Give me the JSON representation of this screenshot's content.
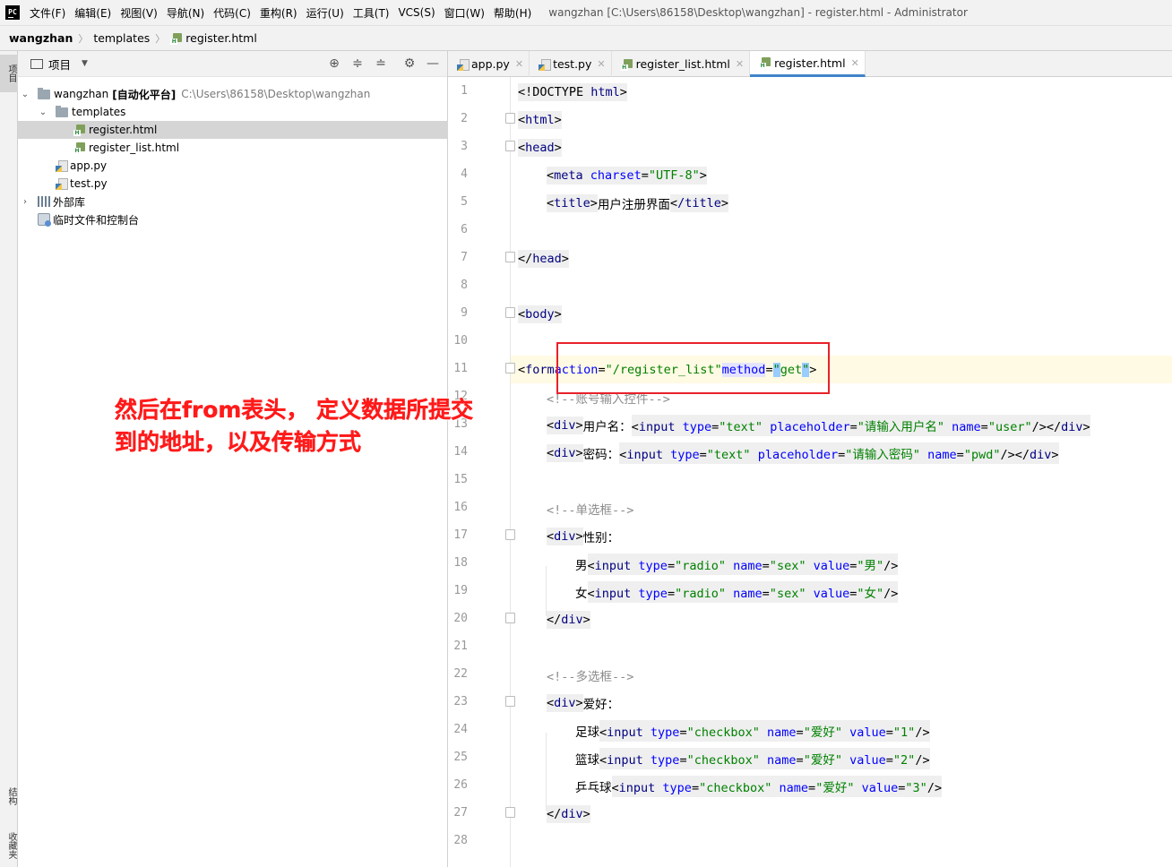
{
  "menubar": {
    "logo": "PC",
    "items": [
      "文件(F)",
      "编辑(E)",
      "视图(V)",
      "导航(N)",
      "代码(C)",
      "重构(R)",
      "运行(U)",
      "工具(T)",
      "VCS(S)",
      "窗口(W)",
      "帮助(H)"
    ],
    "window_title": "wangzhan [C:\\Users\\86158\\Desktop\\wangzhan] - register.html - Administrator"
  },
  "breadcrumb": [
    "wangzhan",
    "templates",
    "register.html"
  ],
  "left_strip": {
    "top": "项目",
    "middle": "结构",
    "bottom": "收藏夹"
  },
  "project_panel": {
    "title": "项目",
    "tree": {
      "root_name": "wangzhan",
      "root_tag": "[自动化平台]",
      "root_path": "C:\\Users\\86158\\Desktop\\wangzhan",
      "templates": "templates",
      "register_html": "register.html",
      "register_list_html": "register_list.html",
      "app_py": "app.py",
      "test_py": "test.py",
      "external_libs": "外部库",
      "scratches": "临时文件和控制台"
    }
  },
  "editor_tabs": [
    "app.py",
    "test.py",
    "register_list.html",
    "register.html"
  ],
  "active_tab": "register.html",
  "line_numbers": [
    "1",
    "2",
    "3",
    "4",
    "5",
    "6",
    "7",
    "8",
    "9",
    "10",
    "11",
    "12",
    "13",
    "14",
    "15",
    "16",
    "17",
    "18",
    "19",
    "20",
    "21",
    "22",
    "23",
    "24",
    "25",
    "26",
    "27",
    "28"
  ],
  "code": {
    "l1": [
      "<!DOCTYPE ",
      "html",
      ">"
    ],
    "l4": [
      "meta",
      "charset",
      "UTF-8"
    ],
    "l5": [
      "title",
      "用户注册界面",
      "/title"
    ],
    "l11": [
      "form",
      "action",
      "/register_list",
      "method",
      "get"
    ],
    "l12": "<!--账号输入控件-->",
    "l13": {
      "label": "用户名：",
      "type": "text",
      "placeholder": "请输入用户名",
      "name": "user"
    },
    "l14": {
      "label": "密码：",
      "type": "text",
      "placeholder": "请输入密码",
      "name": "pwd"
    },
    "l16": "<!--单选框-->",
    "l17": "性别：",
    "l18": {
      "label": "男",
      "type": "radio",
      "name": "sex",
      "value": "男"
    },
    "l19": {
      "label": "女",
      "type": "radio",
      "name": "sex",
      "value": "女"
    },
    "l22": "<!--多选框-->",
    "l23": "爱好：",
    "l24": {
      "label": "足球",
      "type": "checkbox",
      "name": "爱好",
      "value": "1"
    },
    "l25": {
      "label": "篮球",
      "type": "checkbox",
      "name": "爱好",
      "value": "2"
    },
    "l26": {
      "label": "乒乓球",
      "type": "checkbox",
      "name": "爱好",
      "value": "3"
    }
  },
  "annotation": {
    "line1": "然后在from表头， 定义数据所提交",
    "line2": "到的地址，以及传输方式"
  },
  "colors": {
    "highlight_box": "#e8212b",
    "annotation": "#ff1a1a",
    "current_line": "#fffae3",
    "active_tab_underline": "#4083c9"
  }
}
